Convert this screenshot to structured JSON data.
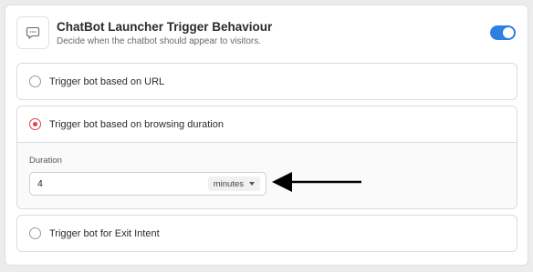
{
  "header": {
    "title": "ChatBot Launcher Trigger Behaviour",
    "subtitle": "Decide when the chatbot should appear to visitors.",
    "icon": "chat-bubble-icon",
    "toggle_enabled": true
  },
  "options": [
    {
      "label": "Trigger bot based on URL",
      "selected": false
    },
    {
      "label": "Trigger bot based on browsing duration",
      "selected": true
    },
    {
      "label": "Trigger bot for Exit Intent",
      "selected": false
    }
  ],
  "duration": {
    "label": "Duration",
    "value": "4",
    "unit": "minutes"
  },
  "colors": {
    "toggle_on": "#2f7fe0",
    "radio_selected": "#e4414a"
  }
}
